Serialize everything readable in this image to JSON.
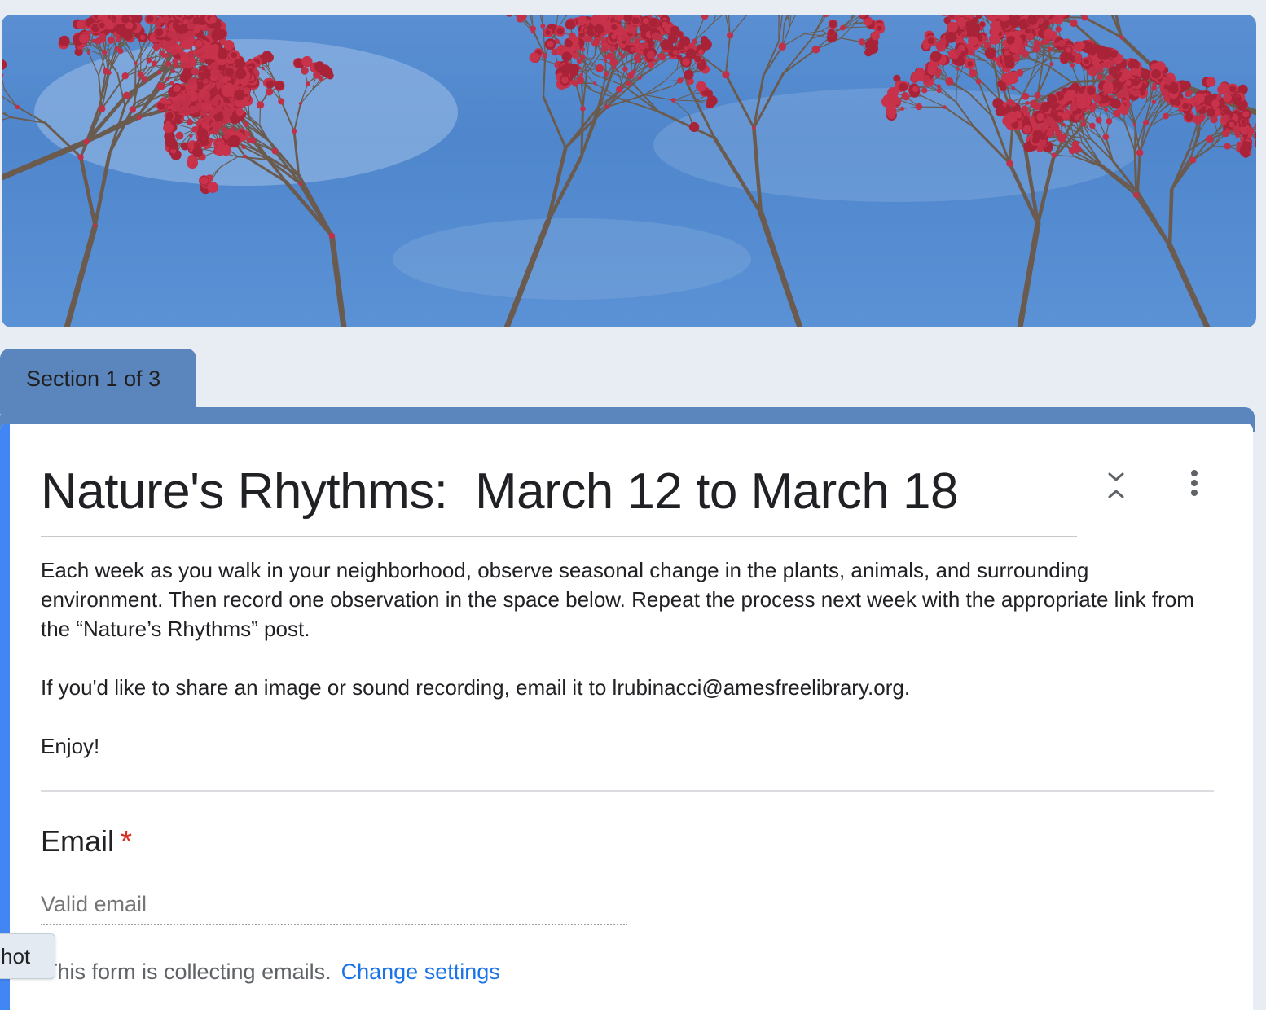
{
  "banner": {
    "description": "header-image-red-maple-blossoms"
  },
  "section_tab": {
    "label": "Section 1 of 3"
  },
  "form": {
    "title": "Nature's Rhythms:  March 12 to March 18",
    "description": [
      "Each week as you walk in your neighborhood, observe seasonal change in the plants, animals, and surrounding environment. Then record one observation in the space below. Repeat the process next week with the appropriate link from the “Nature’s Rhythms” post.",
      "If you'd like to share an image or sound recording, email it to lrubinacci@amesfreelibrary.org.",
      "Enjoy!"
    ]
  },
  "question": {
    "title": "Email",
    "required_mark": "*",
    "placeholder": "Valid email"
  },
  "notice": {
    "text": "This form is collecting emails.",
    "link_label": "Change settings"
  },
  "chip": {
    "label": "hot"
  },
  "colors": {
    "page_bg": "#e8edf4",
    "accent": "#4285f4",
    "section_bar": "#5b86bd",
    "link": "#1a73e8",
    "required": "#d93025"
  },
  "icons": {
    "collapse": "collapse-icon",
    "more": "more-vert-icon"
  }
}
